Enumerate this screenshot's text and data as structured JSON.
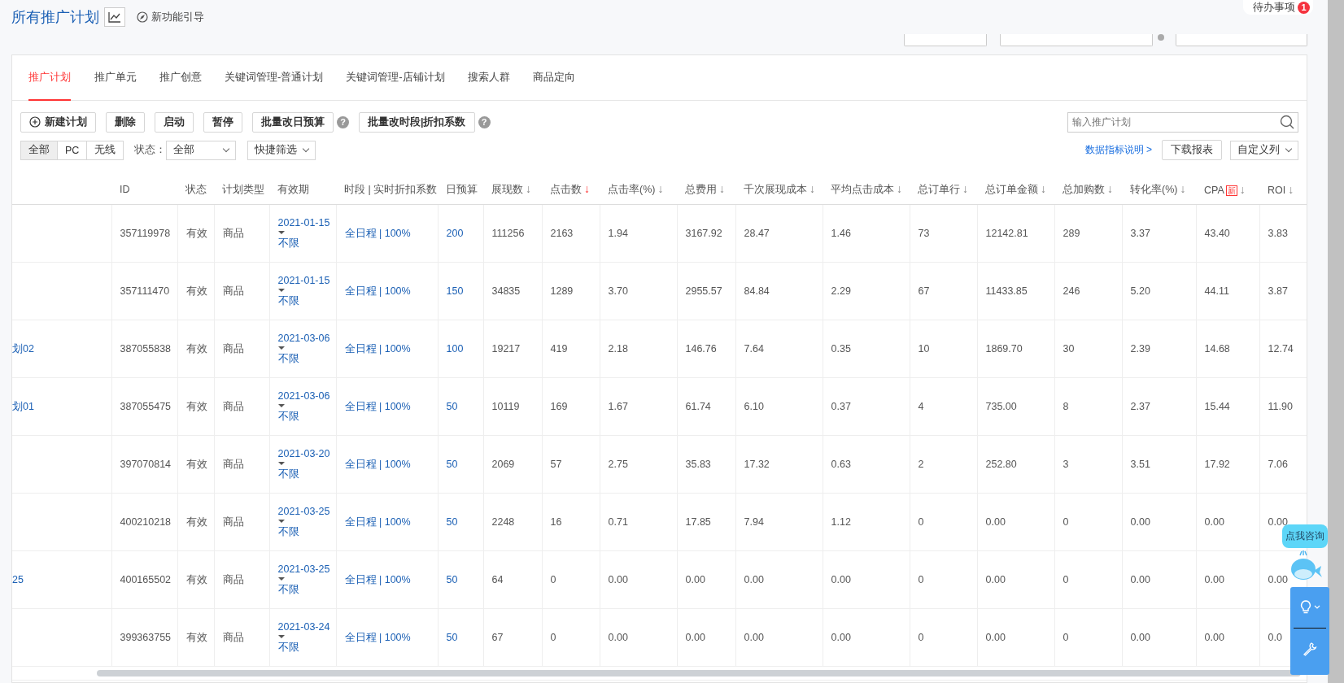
{
  "header": {
    "title": "所有推广计划",
    "guide": "新功能引导",
    "todo": {
      "label": "待办事项",
      "count": "1"
    }
  },
  "tabs": [
    {
      "label": "推广计划",
      "selected": true
    },
    {
      "label": "推广单元",
      "selected": false
    },
    {
      "label": "推广创意",
      "selected": false
    },
    {
      "label": "关键词管理-普通计划",
      "selected": false
    },
    {
      "label": "关键词管理-店铺计划",
      "selected": false
    },
    {
      "label": "搜索人群",
      "selected": false
    },
    {
      "label": "商品定向",
      "selected": false
    }
  ],
  "actions": [
    {
      "label": "新建计划",
      "kind": "add"
    },
    {
      "label": "删除",
      "kind": "plain"
    },
    {
      "label": "启动",
      "kind": "plain"
    },
    {
      "label": "暂停",
      "kind": "plain"
    },
    {
      "label": "批量改日预算",
      "kind": "help",
      "help": "?"
    },
    {
      "label": "批量改时段|折扣系数",
      "kind": "help",
      "help": "?"
    }
  ],
  "search": {
    "placeholder": "输入推广计划"
  },
  "devices": [
    {
      "label": "全部",
      "selected": true
    },
    {
      "label": "PC",
      "selected": false
    },
    {
      "label": "无线",
      "selected": false
    }
  ],
  "status_filter": {
    "label": "状态：",
    "value": "全部"
  },
  "quick_filter": "快捷筛选",
  "metrics_link": "数据指标说明 >",
  "download": "下载报表",
  "custom_columns": "自定义列",
  "columns": [
    {
      "label": "ID"
    },
    {
      "label": "状态"
    },
    {
      "label": "计划类型"
    },
    {
      "label": "有效期"
    },
    {
      "label": "时段 | 实时折扣系数"
    },
    {
      "label": "日预算"
    },
    {
      "label": "展现数",
      "arrow": "↓",
      "active": false
    },
    {
      "label": "点击数",
      "arrow": "↓",
      "active": true
    },
    {
      "label": "点击率(%)",
      "arrow": "↓",
      "active": false
    },
    {
      "label": "总费用",
      "arrow": "↓",
      "active": false
    },
    {
      "label": "千次展现成本",
      "arrow": "↓",
      "active": false
    },
    {
      "label": "平均点击成本",
      "arrow": "↓",
      "active": false
    },
    {
      "label": "总订单行",
      "arrow": "↓",
      "active": false
    },
    {
      "label": "总订单金额",
      "arrow": "↓",
      "active": false
    },
    {
      "label": "总加购数",
      "arrow": "↓",
      "active": false
    },
    {
      "label": "转化率(%)",
      "arrow": "↓",
      "active": false
    },
    {
      "label": "CPA",
      "badge": "新",
      "arrow": "↓",
      "active": false
    },
    {
      "label": "ROI",
      "arrow": "↓",
      "active": false
    }
  ],
  "rows": [
    {
      "id": "357119978",
      "status": "有效",
      "type": "商品",
      "start": "2021-01-15",
      "end": "不限",
      "schedule": "全日程",
      "discount": "| 100%",
      "budget": "200",
      "metrics": [
        "111256",
        "2163",
        "1.94",
        "3167.92",
        "28.47",
        "1.46",
        "73",
        "12142.81",
        "289",
        "3.37",
        "43.40",
        "3.83"
      ]
    },
    {
      "id": "357111470",
      "status": "有效",
      "type": "商品",
      "start": "2021-01-15",
      "end": "不限",
      "schedule": "全日程",
      "discount": "| 100%",
      "budget": "150",
      "metrics": [
        "34835",
        "1289",
        "3.70",
        "2955.57",
        "84.84",
        "2.29",
        "67",
        "11433.85",
        "246",
        "5.20",
        "44.11",
        "3.87"
      ]
    },
    {
      "name": "划02",
      "id": "387055838",
      "status": "有效",
      "type": "商品",
      "start": "2021-03-06",
      "end": "不限",
      "schedule": "全日程",
      "discount": "| 100%",
      "budget": "100",
      "metrics": [
        "19217",
        "419",
        "2.18",
        "146.76",
        "7.64",
        "0.35",
        "10",
        "1869.70",
        "30",
        "2.39",
        "14.68",
        "12.74"
      ]
    },
    {
      "name": "划01",
      "id": "387055475",
      "status": "有效",
      "type": "商品",
      "start": "2021-03-06",
      "end": "不限",
      "schedule": "全日程",
      "discount": "| 100%",
      "budget": "50",
      "metrics": [
        "10119",
        "169",
        "1.67",
        "61.74",
        "6.10",
        "0.37",
        "4",
        "735.00",
        "8",
        "2.37",
        "15.44",
        "11.90"
      ]
    },
    {
      "id": "397070814",
      "status": "有效",
      "type": "商品",
      "start": "2021-03-20",
      "end": "不限",
      "schedule": "全日程",
      "discount": "| 100%",
      "budget": "50",
      "metrics": [
        "2069",
        "57",
        "2.75",
        "35.83",
        "17.32",
        "0.63",
        "2",
        "252.80",
        "3",
        "3.51",
        "17.92",
        "7.06"
      ]
    },
    {
      "id": "400210218",
      "status": "有效",
      "type": "商品",
      "start": "2021-03-25",
      "end": "不限",
      "schedule": "全日程",
      "discount": "| 100%",
      "budget": "50",
      "metrics": [
        "2248",
        "16",
        "0.71",
        "17.85",
        "7.94",
        "1.12",
        "0",
        "0.00",
        "0",
        "0.00",
        "0.00",
        "0.00"
      ]
    },
    {
      "name": "25",
      "id": "400165502",
      "status": "有效",
      "type": "商品",
      "start": "2021-03-25",
      "end": "不限",
      "schedule": "全日程",
      "discount": "| 100%",
      "budget": "50",
      "metrics": [
        "64",
        "0",
        "0.00",
        "0.00",
        "0.00",
        "0.00",
        "0",
        "0.00",
        "0",
        "0.00",
        "0.00",
        "0.00"
      ]
    },
    {
      "id": "399363755",
      "status": "有效",
      "type": "商品",
      "start": "2021-03-24",
      "end": "不限",
      "schedule": "全日程",
      "discount": "| 100%",
      "budget": "50",
      "metrics": [
        "67",
        "0",
        "0.00",
        "0.00",
        "0.00",
        "0.00",
        "0",
        "0.00",
        "0",
        "0.00",
        "0.00",
        "0.0"
      ]
    }
  ],
  "chat": {
    "bubble": "点我咨询"
  }
}
